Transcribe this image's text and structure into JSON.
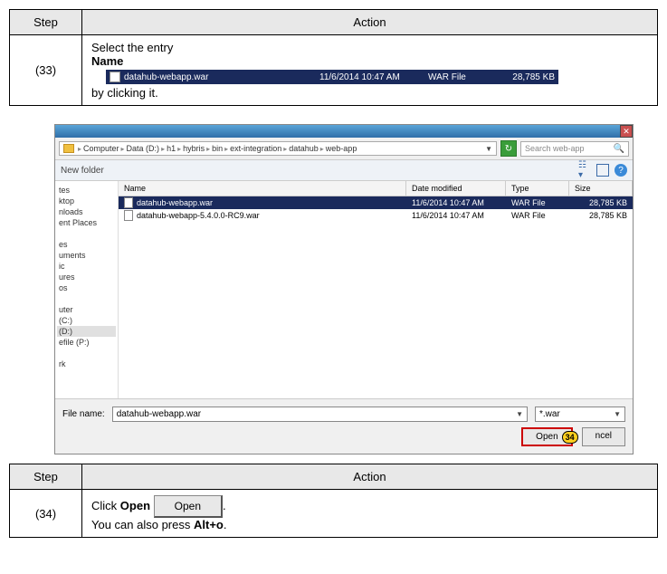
{
  "step33": {
    "step_header": "Step",
    "action_header": "Action",
    "number": "(33)",
    "line1": "Select the entry",
    "name_label": "Name",
    "file": {
      "name": "datahub-webapp.war",
      "date": "11/6/2014 10:47 AM",
      "type": "WAR File",
      "size": "28,785 KB"
    },
    "line2": "by clicking it."
  },
  "dialog": {
    "breadcrumb": [
      "Computer",
      "Data (D:)",
      "h1",
      "hybris",
      "bin",
      "ext-integration",
      "datahub",
      "web-app"
    ],
    "search_placeholder": "Search web-app",
    "toolbar_newfolder": "New folder",
    "columns": {
      "name": "Name",
      "date": "Date modified",
      "type": "Type",
      "size": "Size"
    },
    "files": [
      {
        "name": "datahub-webapp.war",
        "date": "11/6/2014 10:47 AM",
        "type": "WAR File",
        "size": "28,785 KB",
        "selected": true
      },
      {
        "name": "datahub-webapp-5.4.0.0-RC9.war",
        "date": "11/6/2014 10:47 AM",
        "type": "WAR File",
        "size": "28,785 KB",
        "selected": false
      }
    ],
    "sidebar": [
      "tes",
      "ktop",
      "nloads",
      "ent Places",
      "",
      "es",
      "uments",
      "ic",
      "ures",
      "os",
      "",
      "uter",
      "(C:)",
      "(D:)",
      "efile (P:)",
      "",
      "rk"
    ],
    "sidebar_selected": "(D:)",
    "filename_label": "File name:",
    "filename_value": "datahub-webapp.war",
    "filter_value": "*.war",
    "open_label": "Open",
    "cancel_label": "ncel",
    "callout": "34"
  },
  "step34": {
    "step_header": "Step",
    "action_header": "Action",
    "number": "(34)",
    "prefix": "Click ",
    "bold_open": "Open",
    "btn_label": "Open",
    "suffix": ".",
    "line2a": "You can also press ",
    "alt_o": "Alt+o",
    "line2b": "."
  }
}
